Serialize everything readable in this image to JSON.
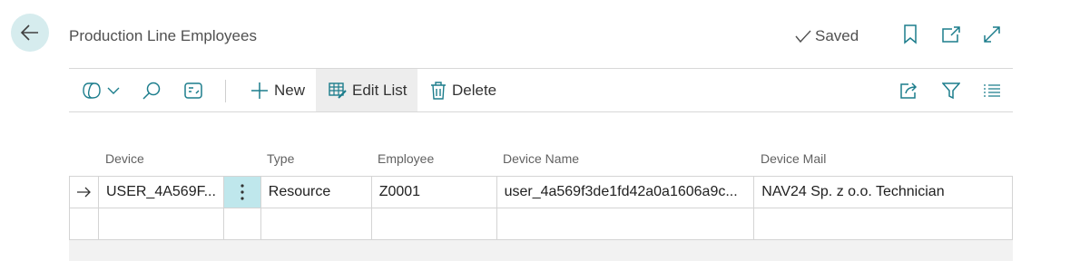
{
  "header": {
    "title": "Production Line Employees",
    "saved_label": "Saved",
    "icons": [
      "arrow-left-icon",
      "checkmark-icon",
      "bookmark-icon",
      "open-new-window-icon",
      "expand-icon"
    ]
  },
  "toolbar": {
    "new_label": "New",
    "edit_list_label": "Edit List",
    "delete_label": "Delete",
    "icons": [
      "copilot-icon",
      "chevron-down-icon",
      "search-icon",
      "analyze-icon",
      "share-icon",
      "filter-icon",
      "list-view-icon"
    ]
  },
  "table": {
    "columns": [
      "Device",
      "Type",
      "Employee",
      "Device Name",
      "Device Mail"
    ],
    "rows": [
      {
        "device": "USER_4A569F...",
        "type": "Resource",
        "employee": "Z0001",
        "device_name": "user_4a569f3de1fd42a0a1606a9c...",
        "device_mail": "NAV24 Sp. z o.o. Technician"
      }
    ]
  },
  "colors": {
    "accent": "#bfe7ec",
    "back_button": "#d6ecee",
    "icon_teal": "#1c7d8c"
  }
}
